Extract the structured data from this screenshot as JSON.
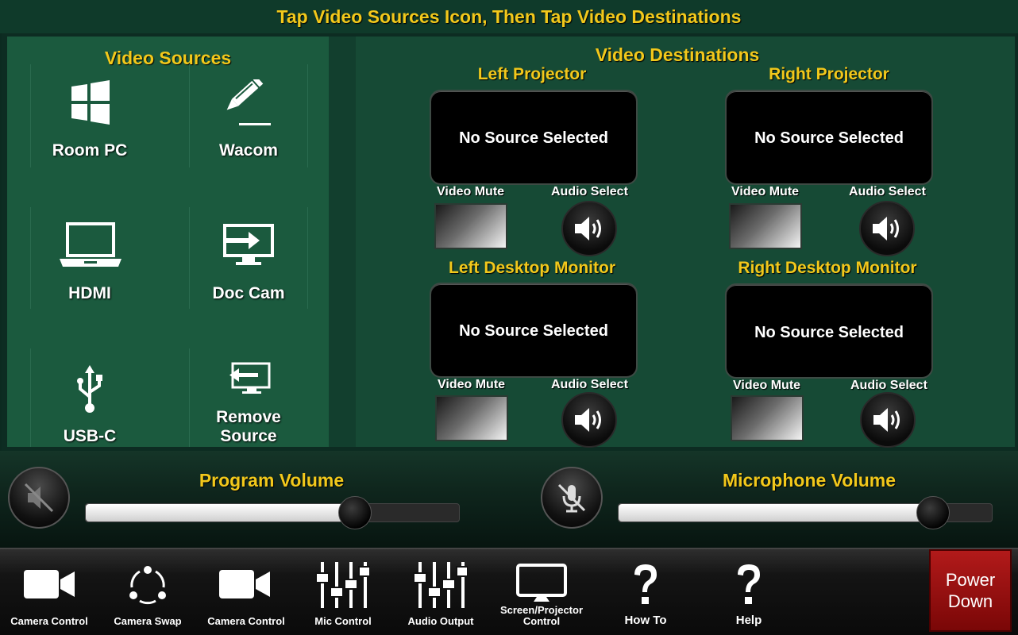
{
  "header": {
    "title": "Tap Video Sources Icon, Then Tap Video Destinations"
  },
  "sources": {
    "title": "Video Sources",
    "items": [
      {
        "label": "Room PC",
        "icon": "windows-icon"
      },
      {
        "label": "Wacom",
        "icon": "pen-icon"
      },
      {
        "label": "HDMI",
        "icon": "laptop-icon"
      },
      {
        "label": "Doc Cam",
        "icon": "doc-cam-icon"
      },
      {
        "label": "USB-C",
        "icon": "usb-icon"
      },
      {
        "label_line1": "Remove",
        "label_line2": "Source",
        "icon": "remove-source-icon"
      }
    ]
  },
  "destinations": {
    "title": "Video Destinations",
    "video_mute_label": "Video Mute",
    "audio_select_label": "Audio Select",
    "items": [
      {
        "name": "Left Projector",
        "status": "No Source Selected"
      },
      {
        "name": "Right Projector",
        "status": "No Source Selected"
      },
      {
        "name": "Left Desktop Monitor",
        "status": "No Source Selected"
      },
      {
        "name": "Right Desktop Monitor",
        "status": "No Source Selected"
      }
    ]
  },
  "volume": {
    "program": {
      "title": "Program Volume",
      "level": 0.72
    },
    "microphone": {
      "title": "Microphone Volume",
      "level": 0.84
    }
  },
  "nav": [
    {
      "label": "Camera Control",
      "icon": "camera-icon"
    },
    {
      "label": "Camera Swap",
      "icon": "camera-swap-icon"
    },
    {
      "label": "Camera Control",
      "icon": "camera-icon"
    },
    {
      "label": "Mic Control",
      "icon": "mixer-icon"
    },
    {
      "label": "Audio Output",
      "icon": "mixer-icon"
    },
    {
      "label_line1": "Screen/Projector",
      "label_line2": "Control",
      "icon": "monitor-icon"
    },
    {
      "label": "How To",
      "icon": "question-icon"
    },
    {
      "label": "Help",
      "icon": "question-icon"
    }
  ],
  "power": {
    "line1": "Power",
    "line2": "Down"
  },
  "colors": {
    "accent_yellow": "#f2c81b",
    "panel_green": "#1b5a3e",
    "power_red": "#b21a1a"
  }
}
